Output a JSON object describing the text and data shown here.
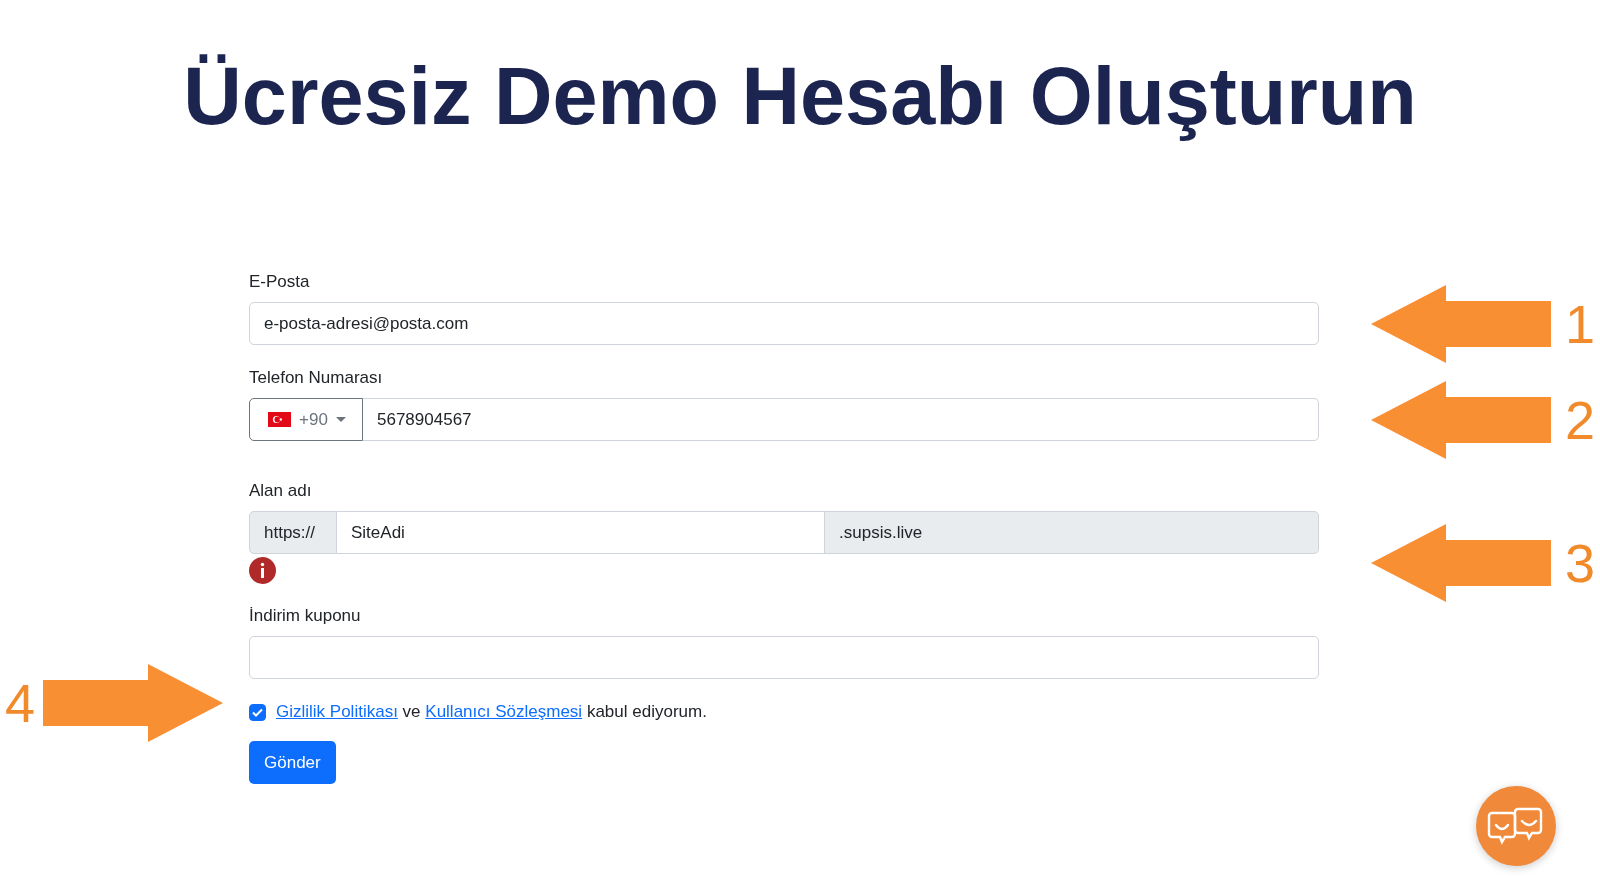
{
  "title": "Ücresiz Demo Hesabı Oluşturun",
  "email": {
    "label": "E-Posta",
    "value": "e-posta-adresi@posta.com",
    "step_number": "1"
  },
  "phone": {
    "label": "Telefon Numarası",
    "country_code": "+90",
    "value": "5678904567",
    "step_number": "2"
  },
  "domain": {
    "label": "Alan adı",
    "prefix": "https://",
    "value": "SiteAdi",
    "suffix": ".supsis.live",
    "error": true,
    "step_number": "3"
  },
  "coupon": {
    "label": "İndirim kuponu"
  },
  "consent": {
    "checked": true,
    "parts": [
      {
        "kind": "link",
        "text": "Gizlilik Politikası"
      },
      {
        "kind": "text",
        "text": "ve"
      },
      {
        "kind": "link",
        "text": "Kullanıcı Sözleşmesi"
      },
      {
        "kind": "text",
        "text": "kabul ediyorum."
      }
    ],
    "step_number": "4"
  },
  "submit": "Gönder"
}
